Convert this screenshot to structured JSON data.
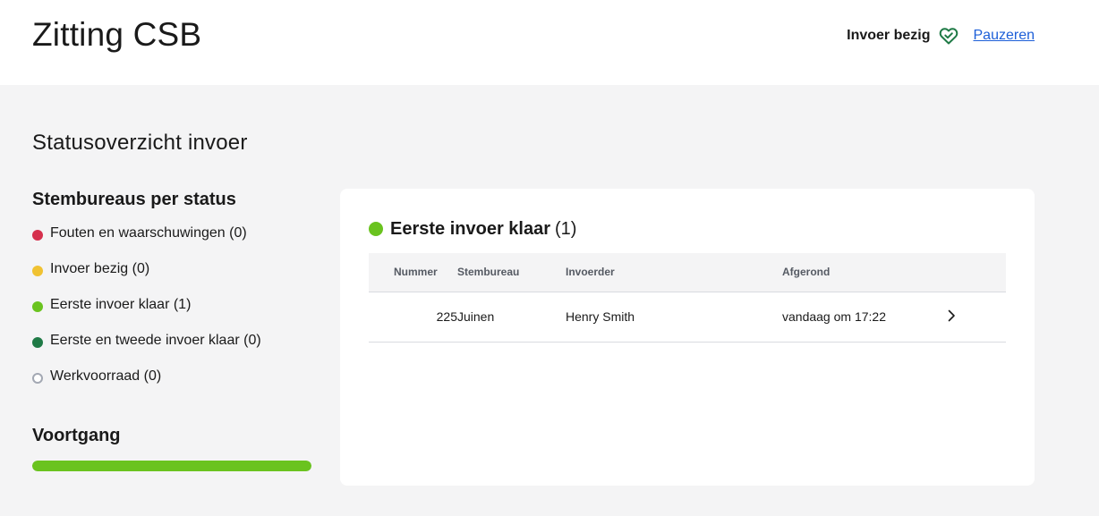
{
  "app": {
    "title": "Zitting CSB",
    "status": "Invoer bezig",
    "pause_label": "Pauzeren"
  },
  "page": {
    "heading": "Statusoverzicht invoer"
  },
  "sidebar": {
    "status_heading": "Stembureaus per status",
    "statuses": [
      {
        "label": "Fouten en waarschuwingen (0)",
        "color": "#d5304d"
      },
      {
        "label": "Invoer bezig (0)",
        "color": "#f0c232"
      },
      {
        "label": "Eerste invoer klaar (1)",
        "color": "#6ac31f"
      },
      {
        "label": "Eerste en tweede invoer klaar (0)",
        "color": "#1f7a46"
      },
      {
        "label": "Werkvoorraad (0)",
        "color": "#a3a8b3"
      }
    ],
    "progress_heading": "Voortgang",
    "progress_fraction": 1.0
  },
  "card": {
    "title": "Eerste invoer klaar",
    "count": "(1)",
    "color": "#6ac31f",
    "columns": [
      "Nummer",
      "Stembureau",
      "Invoerder",
      "Afgerond"
    ],
    "rows": [
      {
        "nummer": "225",
        "stembureau": "Juinen",
        "invoerder": "Henry Smith",
        "afgerond": "vandaag om 17:22"
      }
    ]
  },
  "icons": {
    "status_icon": "heart-check-icon",
    "row_icon": "chevron-right-icon"
  }
}
